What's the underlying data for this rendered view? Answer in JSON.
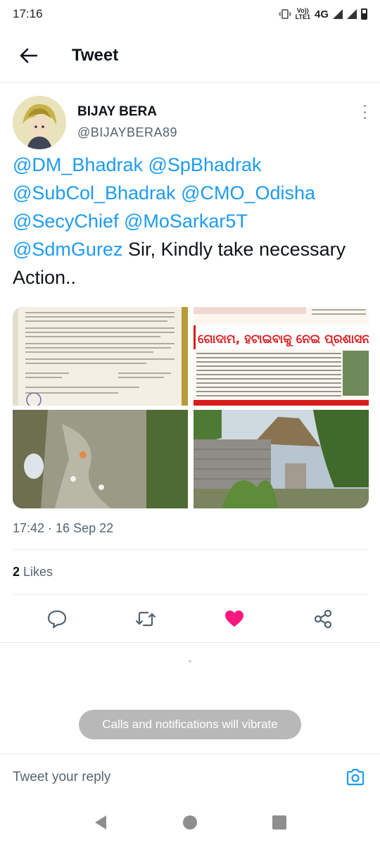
{
  "status_bar": {
    "time": "17:16",
    "volte_line1": "Vo))",
    "volte_line2": "LTE1",
    "network": "4G",
    "icons": [
      "vibrate-icon",
      "signal-icon",
      "signal-icon",
      "battery-icon"
    ]
  },
  "header": {
    "back_icon": "arrow-left-icon",
    "title": "Tweet"
  },
  "tweet": {
    "author_name": "BIJAY BERA",
    "author_handle": "@BIJAYBERA89",
    "mentions": [
      "@DM_Bhadrak",
      "@SpBhadrak",
      "@SubCol_Bhadrak",
      "@CMO_Odisha",
      "@SecyChief",
      "@MoSarkar5T",
      "@SdmGurez"
    ],
    "text_body": "Sir, Kindly take necessary Action..",
    "media": [
      {
        "description_icon": "document-photo"
      },
      {
        "description_icon": "newspaper-clipping-photo",
        "headline": "ଗୋଦାମ, ହଟାଇବାକୁ ନେଇ ପ୍ରଶାସନକୁ ଜଣା"
      },
      {
        "description_icon": "drain-water-photo"
      },
      {
        "description_icon": "house-photo"
      }
    ],
    "timestamp": "17:42 · 16 Sep 22",
    "likes_count": "2",
    "likes_label": "Likes"
  },
  "actions": {
    "reply_icon": "comment-icon",
    "retweet_icon": "retweet-icon",
    "like_icon": "heart-icon",
    "share_icon": "share-icon",
    "like_color": "#f91880"
  },
  "toast": {
    "message": "Calls and notifications will vibrate"
  },
  "reply_bar": {
    "placeholder": "Tweet your reply",
    "camera_icon": "camera-icon",
    "accent": "#1d9bf0"
  },
  "navbar": {
    "icons": [
      "back-triangle-icon",
      "home-circle-icon",
      "recents-square-icon"
    ]
  }
}
